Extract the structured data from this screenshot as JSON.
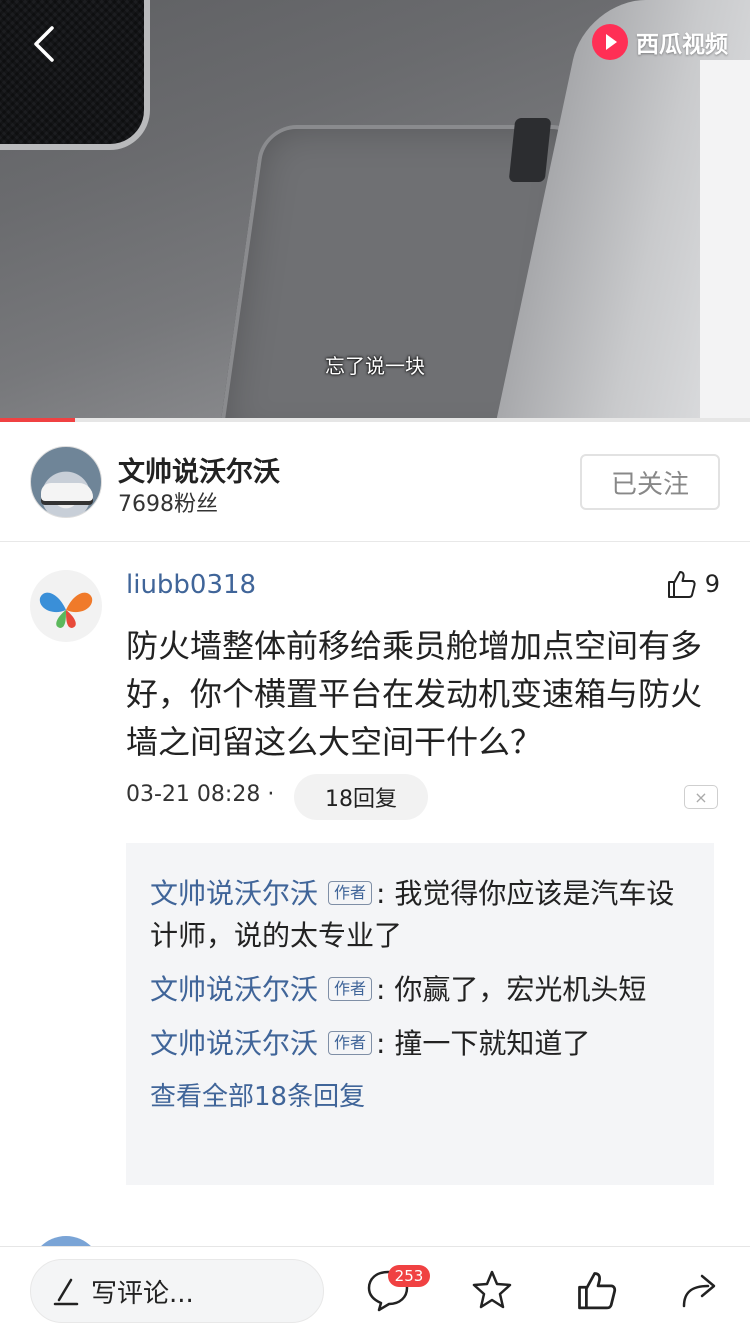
{
  "video": {
    "subtitle": "忘了说一块",
    "brand_label": "西瓜视频",
    "progress": 0.1
  },
  "author": {
    "name": "文帅说沃尔沃",
    "fans": "7698粉丝",
    "follow_label": "已关注"
  },
  "comment": {
    "user": "liubb0318",
    "likes": "9",
    "text": "防火墙整体前移给乘员舱增加点空间有多好，你个横置平台在发动机变速箱与防火墙之间留这么大空间干什么？",
    "time": "03-21 08:28 · ",
    "reply_count_label": "18回复",
    "close_label": "×",
    "replies": [
      {
        "name": "文帅说沃尔沃",
        "tag": "作者",
        "text": ": 我觉得你应该是汽车设计师，说的太专业了"
      },
      {
        "name": "文帅说沃尔沃",
        "tag": "作者",
        "text": ": 你赢了，宏光机头短"
      },
      {
        "name": "文帅说沃尔沃",
        "tag": "作者",
        "text": ": 撞一下就知道了"
      }
    ],
    "view_all": "查看全部18条回复"
  },
  "bottom_bar": {
    "write_placeholder": "写评论...",
    "comment_badge": "253"
  },
  "colors": {
    "link_blue": "#406599",
    "accent_red": "#f04142"
  },
  "icons": [
    "back-arrow-icon",
    "xigua-logo-icon",
    "thumb-up-icon",
    "pencil-icon",
    "comment-bubble-icon",
    "star-icon",
    "share-icon"
  ]
}
